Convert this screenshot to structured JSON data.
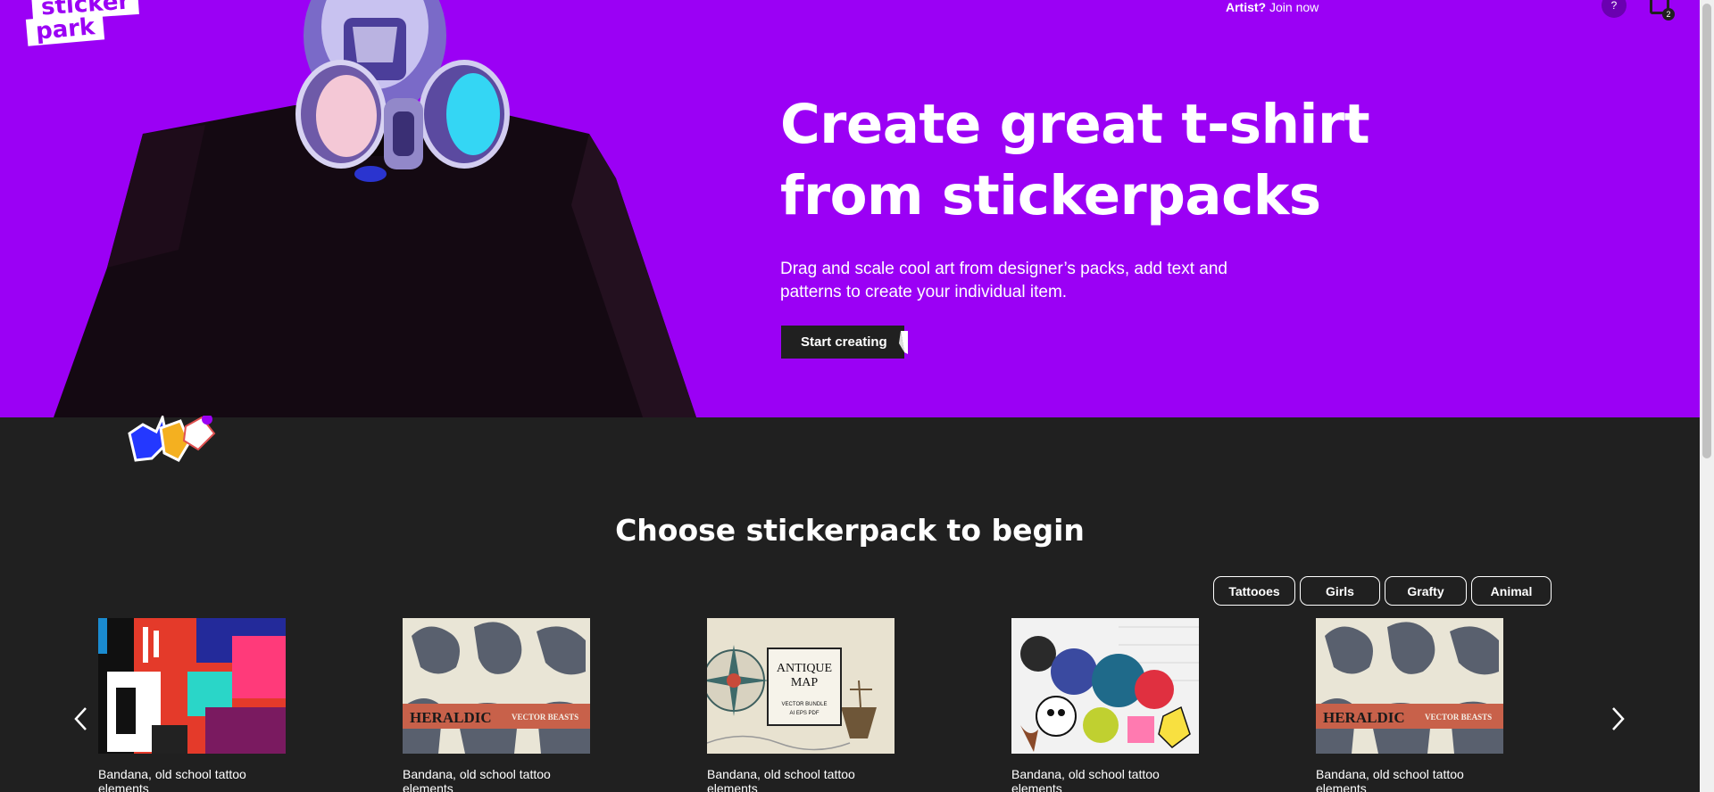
{
  "brand": {
    "logo_line1": "sticker",
    "logo_line2": "park"
  },
  "nav": {
    "artist_prefix": "Artist?",
    "join_label": "Join now",
    "help_label": "?",
    "cart_count": "2"
  },
  "hero": {
    "title_line1": "Create great t-shirt",
    "title_line2": "from stickerpacks",
    "subtitle": "Drag and scale cool art from designer’s packs, add text and patterns to create your individual item.",
    "cta_label": "Start creating"
  },
  "section": {
    "title": "Choose stickerpack to begin",
    "filters": [
      "Tattooes",
      "Girls",
      "Grafty",
      "Animal"
    ]
  },
  "packs": [
    {
      "caption": "Bandana, old school tattoo elements",
      "thumb": "collage"
    },
    {
      "caption": "Bandana, old school tattoo elements",
      "thumb": "heraldic",
      "banner_left": "HERALDIC",
      "banner_right": "VECTOR BEASTS"
    },
    {
      "caption": "Bandana, old school tattoo elements",
      "thumb": "antique-map",
      "title1": "ANTIQUE",
      "title2": "MAP",
      "small1": "VECTOR BUNDLE",
      "small2": "AI EPS PDF"
    },
    {
      "caption": "Bandana, old school tattoo elements",
      "thumb": "graffiti"
    },
    {
      "caption": "Bandana, old school tattoo elements",
      "thumb": "heraldic",
      "banner_left": "HERALDIC",
      "banner_right": "VECTOR BEASTS"
    }
  ],
  "colors": {
    "hero_bg": "#9b00f5",
    "page_bg": "#202020",
    "text": "#ffffff"
  },
  "icons": [
    "help-icon",
    "cart-icon",
    "chevron-left-icon",
    "chevron-right-icon"
  ]
}
